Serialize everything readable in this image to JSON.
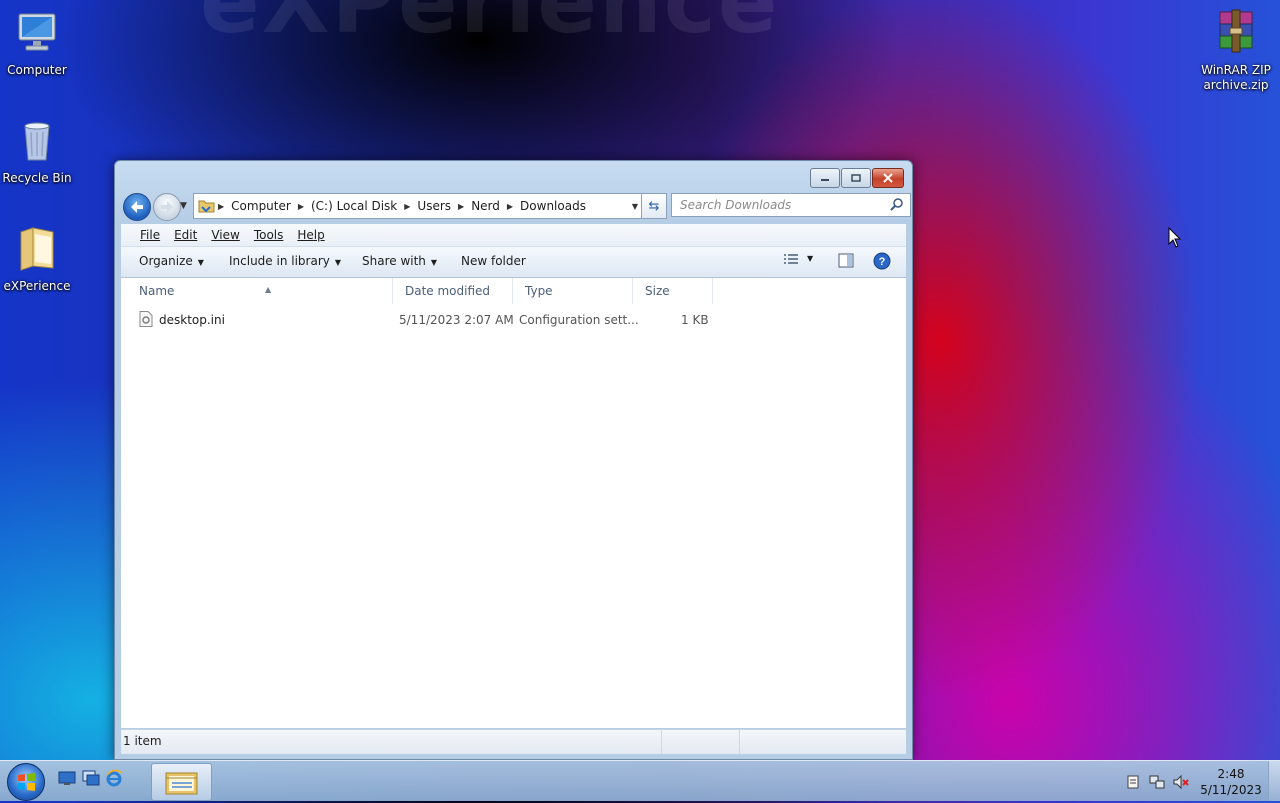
{
  "desktop": {
    "watermark": "eXPerience",
    "icons": [
      {
        "label": "Computer",
        "icon": "computer-icon"
      },
      {
        "label": "Recycle Bin",
        "icon": "recycle-bin-icon"
      },
      {
        "label": "eXPerience",
        "icon": "folder-icon"
      },
      {
        "label": "WinRAR ZIP archive.zip",
        "icon": "winrar-archive-icon"
      }
    ]
  },
  "window": {
    "address": {
      "crumbs": [
        "Computer",
        "(C:) Local Disk",
        "Users",
        "Nerd",
        "Downloads"
      ]
    },
    "search_placeholder": "Search Downloads",
    "menu": [
      "File",
      "Edit",
      "View",
      "Tools",
      "Help"
    ],
    "commands": {
      "organize": "Organize",
      "include_in_library": "Include in library",
      "share_with": "Share with",
      "new_folder": "New folder"
    },
    "columns": [
      "Name",
      "Date modified",
      "Type",
      "Size"
    ],
    "files": [
      {
        "name": "desktop.ini",
        "date_modified": "5/11/2023 2:07 AM",
        "type": "Configuration sett...",
        "size": "1 KB"
      }
    ],
    "status": "1 item"
  },
  "taskbar": {
    "clock_time": "2:48",
    "clock_date": "5/11/2023"
  },
  "colors": {
    "accent": "#1c5fbf",
    "close_button": "#c4422b",
    "window_frame": "#b6cde6"
  }
}
